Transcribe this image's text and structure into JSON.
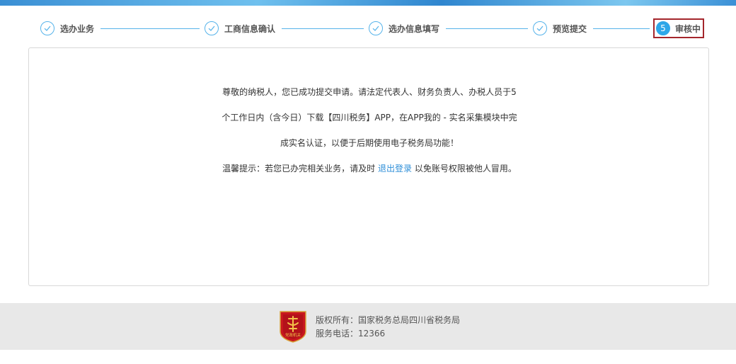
{
  "steps": [
    {
      "label": "选办业务",
      "status": "done"
    },
    {
      "label": "工商信息确认",
      "status": "done"
    },
    {
      "label": "选办信息填写",
      "status": "done"
    },
    {
      "label": "预览提交",
      "status": "done"
    },
    {
      "number": "5",
      "label": "审核中",
      "status": "active"
    }
  ],
  "message": {
    "line1": "尊敬的纳税人，您已成功提交申请。请法定代表人、财务负责人、办税人员于5",
    "line2": "个工作日内（含今日）下载【四川税务】APP，在APP我的 - 实名采集模块中完",
    "line3": "成实名认证，以便于后期使用电子税务局功能！",
    "tip_prefix": "温馨提示：若您已办完相关业务，请及时 ",
    "logout_link": "退出登录",
    "tip_suffix": " 以免账号权限被他人冒用。"
  },
  "footer": {
    "copyright": "版权所有：国家税务总局四川省税务局",
    "phone": "服务电话：12366",
    "emblem_text": "党政机关"
  },
  "colors": {
    "accent": "#2ea7e8",
    "line": "#56b3ea",
    "active_border": "#a4262c",
    "link": "#2f8fd8",
    "footer_bg": "#e8e8e8"
  }
}
